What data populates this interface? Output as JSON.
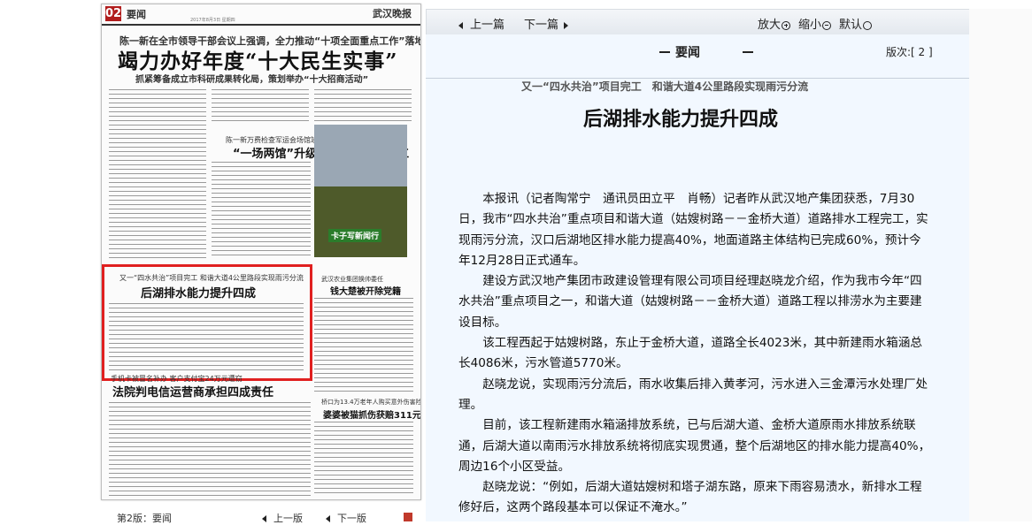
{
  "paper": {
    "page_num": "02",
    "section": "要闻",
    "masthead": "武汉晚报",
    "dateline": "2017年8月3日 星期四",
    "top_kicker": "陈一新在全市领导干部会议上强调，全力推动“十项全面重点工作”落地见效",
    "top_headline": "竭力办好年度“十大民生实事”",
    "top_subhead": "抓紧筹备成立市科研成果转化局，策划举办“十大招商活动”",
    "box_kicker": "陈一新万费检查军运会场馆竣施建设情况",
    "box_title": "“一场两馆”升级改造预计本月开工",
    "photo_tag": "卡子写新闻行",
    "red_kicker": "又一“四水共治”项目完工 和谐大道4公里路段实现雨污分流",
    "red_title": "后湖排水能力提升四成",
    "side_kicker": "武汉农业集团换帅委任",
    "side_title": "钱大楚被开除党籍",
    "lower_kicker": "手机卡被冒名补办 客户支付宝24万元遭窃",
    "lower_title": "法院判电信运营商承担四成责任",
    "right_lower_kicker": "桥口为13.4万老年人购买意外伤害险",
    "right_lower_title": "婆婆被猫抓伤获赔311元",
    "nav_page": "第2版：要闻",
    "nav_prev": "上一版",
    "nav_next": "下一版"
  },
  "toolbar": {
    "prev": "上一篇",
    "next": "下一篇",
    "zoom_in": "放大",
    "zoom_out": "缩小",
    "default": "默认"
  },
  "article": {
    "section": "要闻",
    "edition": "版次:[ 2 ]",
    "kicker": "又一“四水共治”项目完工　和谐大道4公里路段实现雨污分流",
    "title": "后湖排水能力提升四成",
    "paragraphs": [
      "本报讯（记者陶常宁　通讯员田立平　肖畅）记者昨从武汉地产集团获悉，7月30日，我市“四水共治”重点项目和谐大道（姑嫂树路－－金桥大道）道路排水工程完工，实现雨污分流，汉口后湖地区排水能力提高40%，地面道路主体结构已完成60%，预计今年12月28日正式通车。",
      "建设方武汉地产集团市政建设管理有限公司项目经理赵晓龙介绍，作为我市今年“四水共治”重点项目之一，和谐大道（姑嫂树路－－金桥大道）道路工程以排涝水为主要建设目标。",
      "该工程西起于姑嫂树路，东止于金桥大道，道路全长4023米，其中新建雨水箱涵总长4086米，污水管道5770米。",
      "赵晓龙说，实现雨污分流后，雨水收集后排入黄孝河，污水进入三金潭污水处理厂处理。",
      "目前，该工程新建雨水箱涵排放系统，已与后湖大道、金桥大道原雨水排放系统联通，后湖大道以南雨污水排放系统将彻底实现贯通，整个后湖地区的排水能力提高40%，周边16个小区受益。",
      "赵晓龙说：“例如，后湖大道姑嫂树和塔子湖东路，原来下雨容易渍水，新排水工程修好后，这两个路段基本可以保证不淹水。”"
    ]
  }
}
